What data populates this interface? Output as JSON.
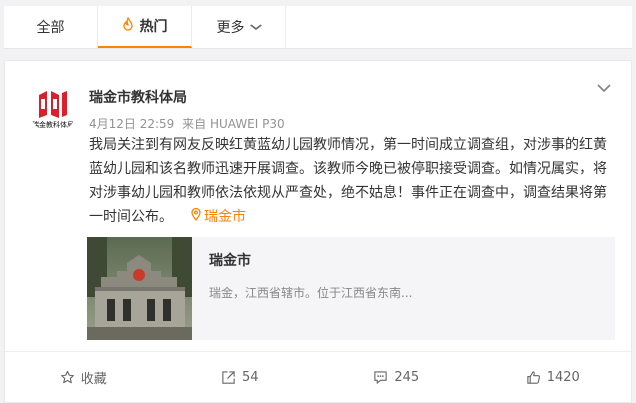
{
  "tabs": [
    {
      "label": "全部",
      "active": false
    },
    {
      "label": "热门",
      "active": true,
      "icon": "fire-icon"
    },
    {
      "label": "更多",
      "active": false,
      "icon": "chevron-down-icon"
    }
  ],
  "post": {
    "author": "瑞金市教科体局",
    "time": "4月12日 22:59",
    "source": "来自 HUAWEI P30",
    "text": "我局关注到有网友反映红黄蓝幼儿园教师情况，第一时间成立调查组，对涉事的红黄蓝幼儿园和该名教师迅速开展调查。该教师今晚已被停职接受调查。如情况属实，将对涉事幼儿园和教师依法依规从严查处，绝不姑息！事件正在调查中，调查结果将第一时间公布。",
    "location": "瑞金市",
    "avatar_text": "瑞金教科体局"
  },
  "place_card": {
    "title": "瑞金市",
    "desc": "瑞金，江西省辖市。位于江西省东南..."
  },
  "actions": {
    "favorite": "收藏",
    "repost": "54",
    "comment": "245",
    "like": "1420"
  },
  "colors": {
    "accent": "#ff8200",
    "avatar_red": "#d9202c"
  }
}
